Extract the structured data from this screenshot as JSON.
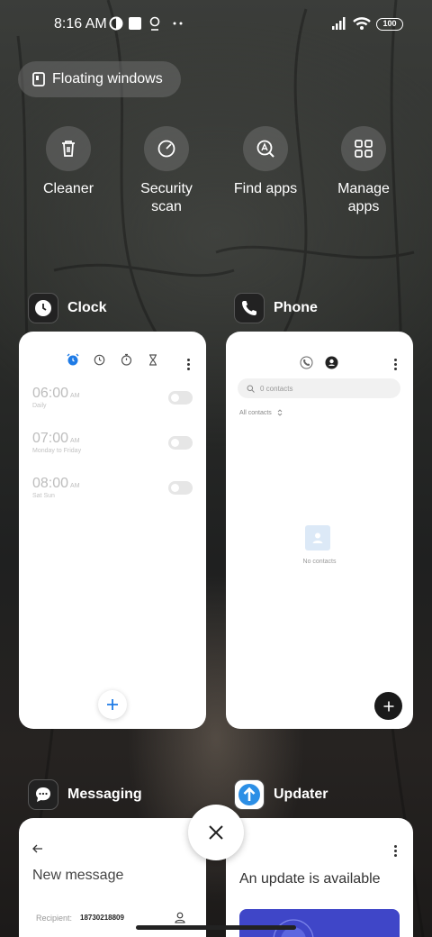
{
  "status_bar": {
    "time": "8:16 AM",
    "battery": "100"
  },
  "floating_windows": {
    "label": "Floating windows"
  },
  "quick_actions": [
    {
      "label": "Cleaner",
      "icon": "trash-icon"
    },
    {
      "label": "Security scan",
      "icon": "security-scan-icon"
    },
    {
      "label": "Find apps",
      "icon": "find-apps-icon"
    },
    {
      "label": "Manage apps",
      "icon": "grid-icon"
    }
  ],
  "apps": {
    "clock": {
      "name": "Clock",
      "alarms": [
        {
          "time": "06:00",
          "ampm": "AM",
          "repeat": "Daily"
        },
        {
          "time": "07:00",
          "ampm": "AM",
          "repeat": "Monday to Friday"
        },
        {
          "time": "08:00",
          "ampm": "AM",
          "repeat": "Sat Sun"
        }
      ]
    },
    "phone": {
      "name": "Phone",
      "search_placeholder": "0 contacts",
      "filter_label": "All contacts",
      "empty_label": "No contacts"
    },
    "messaging": {
      "name": "Messaging",
      "title": "New message",
      "recipient_label": "Recipient:",
      "recipient_value": "18730218809"
    },
    "updater": {
      "name": "Updater",
      "title": "An update is available"
    }
  },
  "colors": {
    "accent_blue": "#1e7be6",
    "updater_blue": "#3f46c8"
  }
}
